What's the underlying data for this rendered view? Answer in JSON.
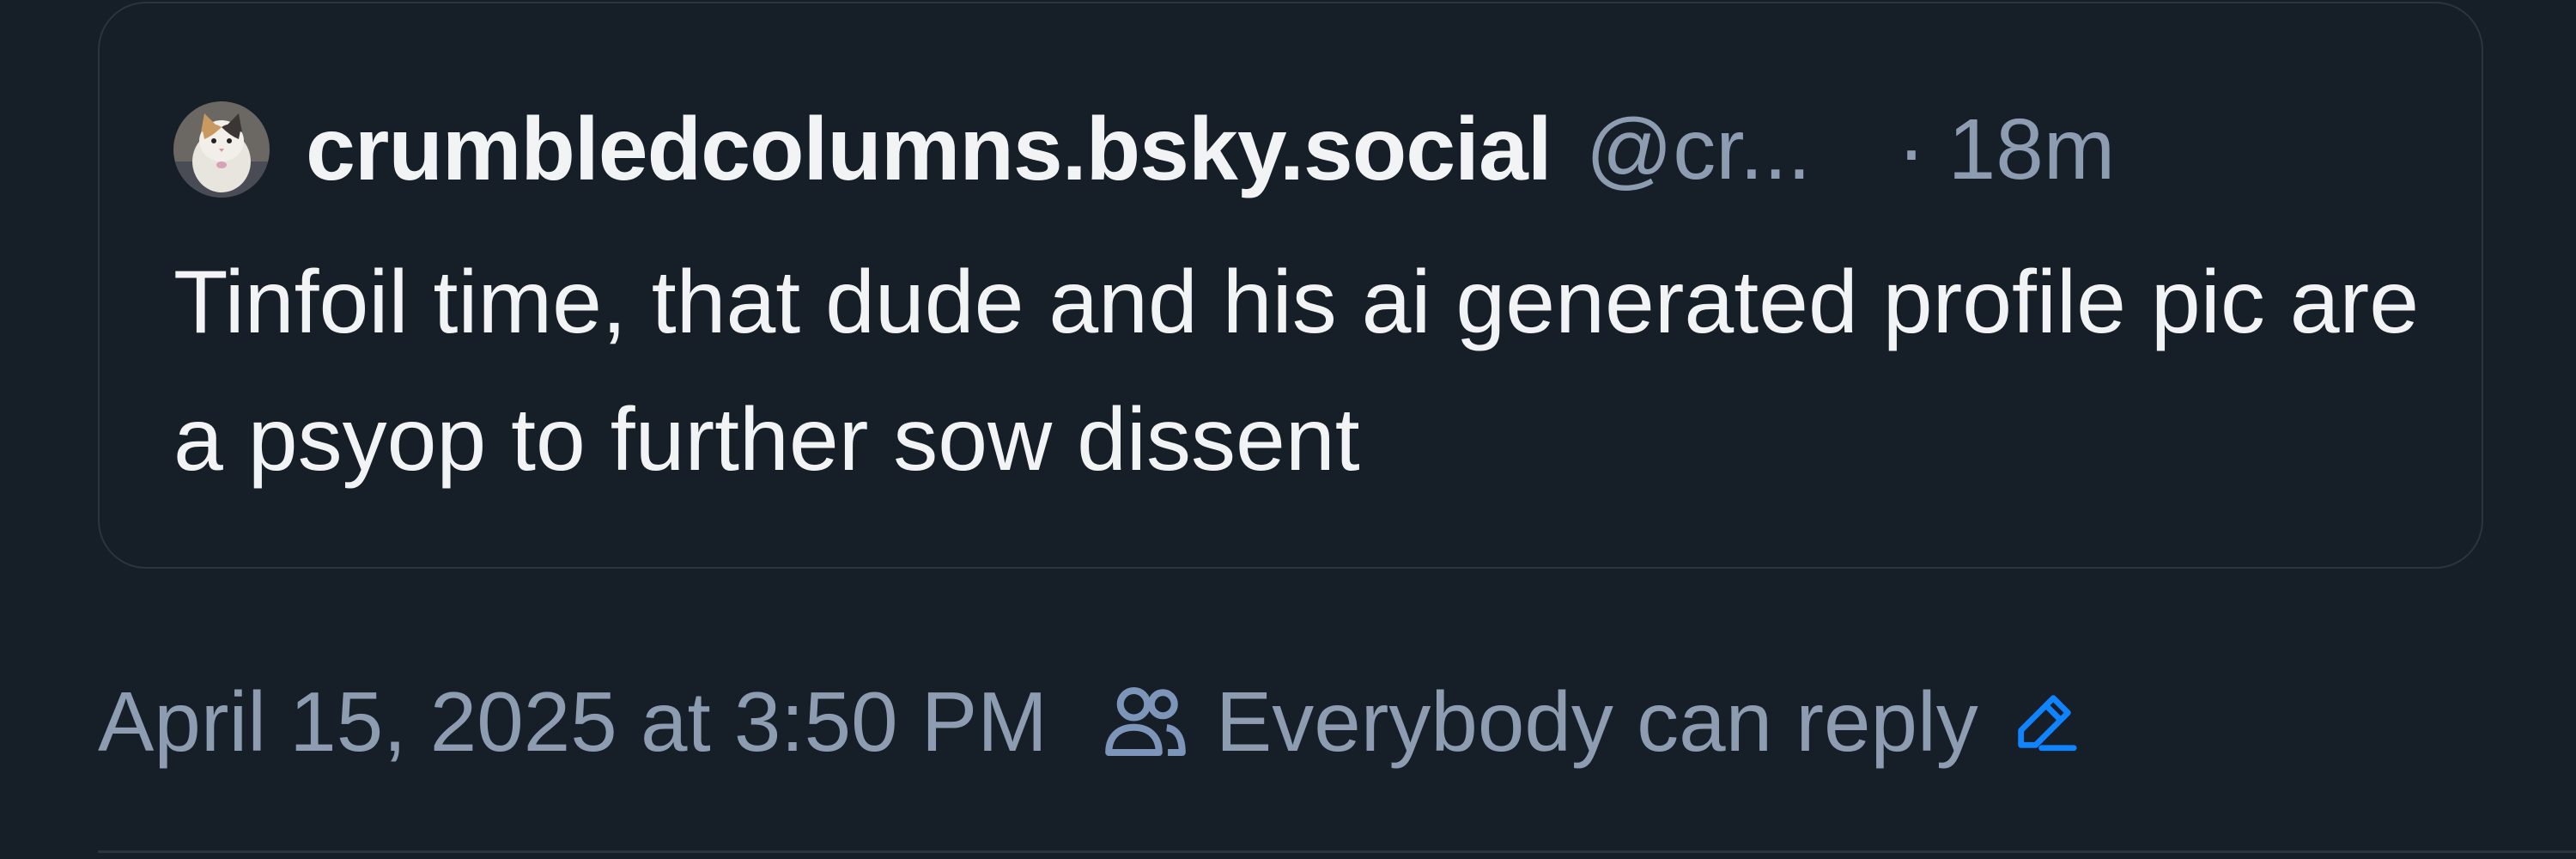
{
  "quote": {
    "display_name": "crumbledcolumns.bsky.social",
    "handle": "@cr...",
    "dot": "·",
    "time_ago": "18m",
    "text": "Tinfoil time, that dude and his ai generated profile pic are a psyop to further sow dissent",
    "avatar_icon": "cat-avatar"
  },
  "meta": {
    "date": "April 15, 2025 at 3:50 PM",
    "reply_setting": "Everybody can reply",
    "people_icon": "people-icon",
    "edit_icon": "pencil-icon"
  },
  "colors": {
    "background": "#161e27",
    "border": "#2a3542",
    "text_primary": "#f1f3f5",
    "text_secondary": "#8d9cb0",
    "accent": "#1083fe"
  }
}
